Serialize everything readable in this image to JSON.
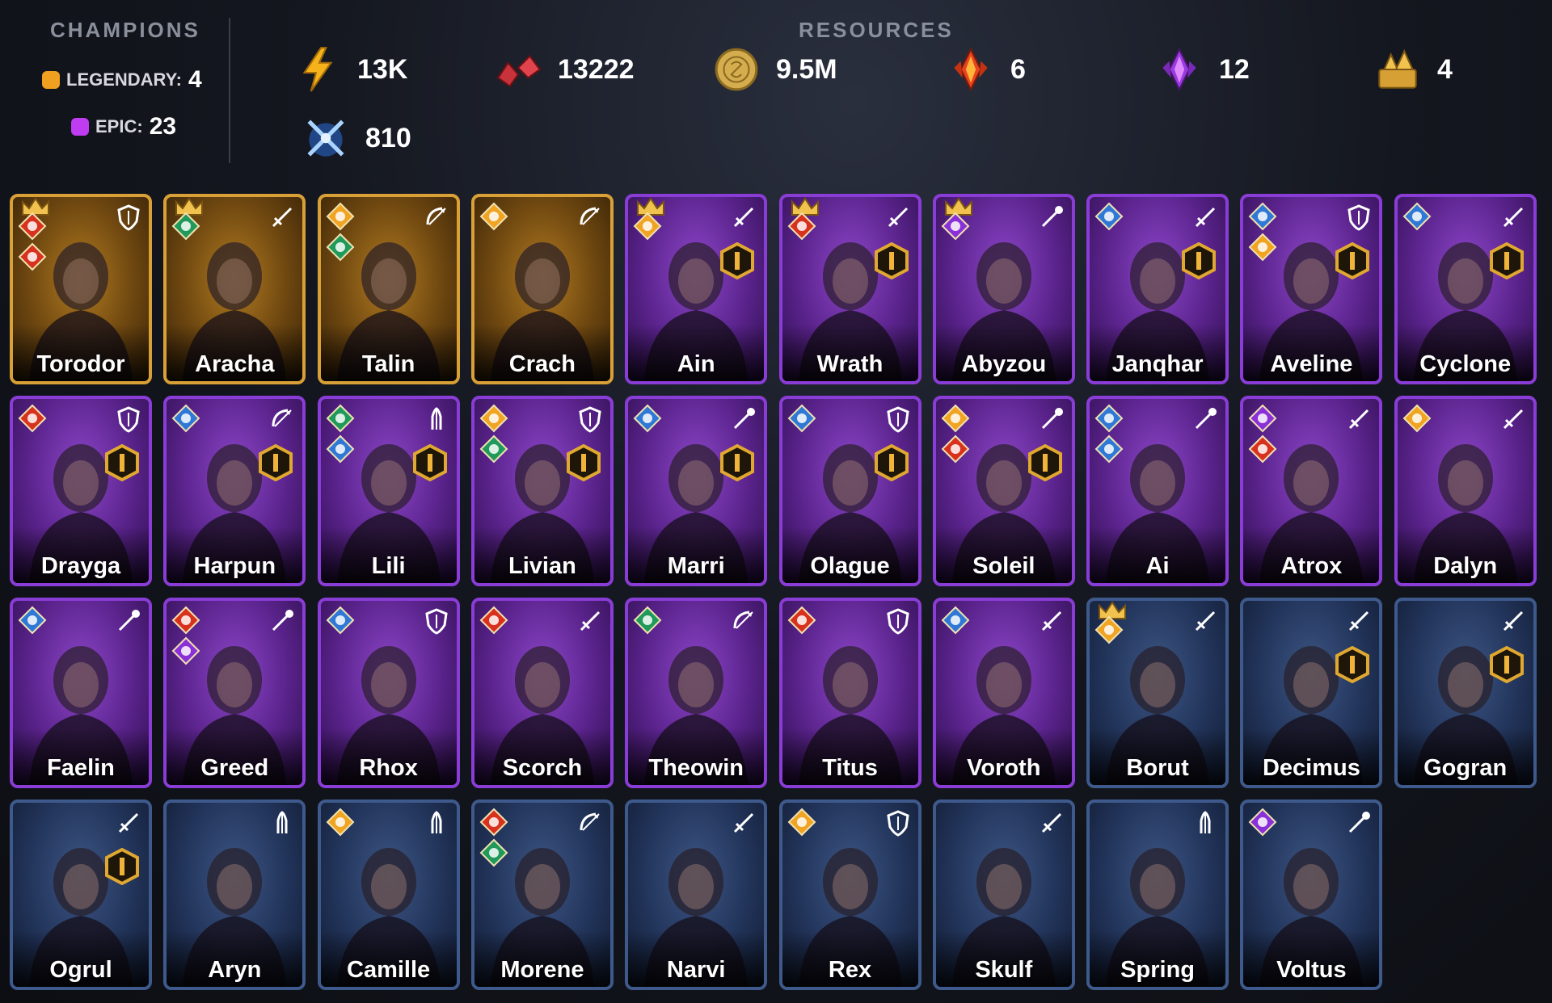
{
  "champions": {
    "title": "CHAMPIONS",
    "legendary_label": "LEGENDARY:",
    "legendary_count": "4",
    "epic_label": "EPIC:",
    "epic_count": "23"
  },
  "resources": {
    "title": "RESOURCES",
    "items": [
      {
        "icon": "energy-bolt-icon",
        "value": "13K"
      },
      {
        "icon": "gem-shards-icon",
        "value": "13222"
      },
      {
        "icon": "gold-coin-icon",
        "value": "9.5M"
      },
      {
        "icon": "fire-crystal-icon",
        "value": "6"
      },
      {
        "icon": "void-crystal-icon",
        "value": "12"
      },
      {
        "icon": "gold-pile-icon",
        "value": "4"
      },
      {
        "icon": "crossed-swords-icon",
        "value": "810"
      }
    ]
  },
  "colors": {
    "legendary": "#f0a020",
    "epic": "#c03cf0",
    "rare": "#3e5a8c"
  },
  "roster": [
    {
      "name": "Torodor",
      "rarity": "legendary",
      "crown": true,
      "affinities": [
        "fire",
        "fire"
      ],
      "role": "shield",
      "ascended": false
    },
    {
      "name": "Aracha",
      "rarity": "legendary",
      "crown": true,
      "affinities": [
        "nature"
      ],
      "role": "sword",
      "ascended": false
    },
    {
      "name": "Talin",
      "rarity": "legendary",
      "crown": false,
      "affinities": [
        "radiant",
        "nature"
      ],
      "role": "bow",
      "ascended": false
    },
    {
      "name": "Crach",
      "rarity": "legendary",
      "crown": false,
      "affinities": [
        "radiant"
      ],
      "role": "bow",
      "ascended": false
    },
    {
      "name": "Ain",
      "rarity": "epic",
      "crown": true,
      "affinities": [
        "radiant"
      ],
      "role": "sword",
      "ascended": true
    },
    {
      "name": "Wrath",
      "rarity": "epic",
      "crown": true,
      "affinities": [
        "fire"
      ],
      "role": "sword",
      "ascended": true
    },
    {
      "name": "Abyzou",
      "rarity": "epic",
      "crown": true,
      "affinities": [
        "void"
      ],
      "role": "staff",
      "ascended": false
    },
    {
      "name": "Janqhar",
      "rarity": "epic",
      "crown": false,
      "affinities": [
        "water"
      ],
      "role": "sword",
      "ascended": true
    },
    {
      "name": "Aveline",
      "rarity": "epic",
      "crown": false,
      "affinities": [
        "water",
        "radiant"
      ],
      "role": "shield",
      "ascended": true
    },
    {
      "name": "Cyclone",
      "rarity": "epic",
      "crown": false,
      "affinities": [
        "water"
      ],
      "role": "sword",
      "ascended": true
    },
    {
      "name": "Drayga",
      "rarity": "epic",
      "crown": false,
      "affinities": [
        "fire"
      ],
      "role": "shield",
      "ascended": true
    },
    {
      "name": "Harpun",
      "rarity": "epic",
      "crown": false,
      "affinities": [
        "water"
      ],
      "role": "bow",
      "ascended": true
    },
    {
      "name": "Lili",
      "rarity": "epic",
      "crown": false,
      "affinities": [
        "nature",
        "water"
      ],
      "role": "prayer",
      "ascended": true
    },
    {
      "name": "Livian",
      "rarity": "epic",
      "crown": false,
      "affinities": [
        "radiant",
        "nature"
      ],
      "role": "shield",
      "ascended": true
    },
    {
      "name": "Marri",
      "rarity": "epic",
      "crown": false,
      "affinities": [
        "water"
      ],
      "role": "staff",
      "ascended": true
    },
    {
      "name": "Olague",
      "rarity": "epic",
      "crown": false,
      "affinities": [
        "water"
      ],
      "role": "shield",
      "ascended": true
    },
    {
      "name": "Soleil",
      "rarity": "epic",
      "crown": false,
      "affinities": [
        "radiant",
        "fire"
      ],
      "role": "staff",
      "ascended": true
    },
    {
      "name": "Ai",
      "rarity": "epic",
      "crown": false,
      "affinities": [
        "water",
        "water"
      ],
      "role": "staff",
      "ascended": false
    },
    {
      "name": "Atrox",
      "rarity": "epic",
      "crown": false,
      "affinities": [
        "void",
        "fire"
      ],
      "role": "sword",
      "ascended": false
    },
    {
      "name": "Dalyn",
      "rarity": "epic",
      "crown": false,
      "affinities": [
        "radiant"
      ],
      "role": "sword",
      "ascended": false
    },
    {
      "name": "Faelin",
      "rarity": "epic",
      "crown": false,
      "affinities": [
        "water"
      ],
      "role": "staff",
      "ascended": false
    },
    {
      "name": "Greed",
      "rarity": "epic",
      "crown": false,
      "affinities": [
        "fire",
        "void"
      ],
      "role": "staff",
      "ascended": false
    },
    {
      "name": "Rhox",
      "rarity": "epic",
      "crown": false,
      "affinities": [
        "water"
      ],
      "role": "shield",
      "ascended": false
    },
    {
      "name": "Scorch",
      "rarity": "epic",
      "crown": false,
      "affinities": [
        "fire"
      ],
      "role": "sword",
      "ascended": false
    },
    {
      "name": "Theowin",
      "rarity": "epic",
      "crown": false,
      "affinities": [
        "nature"
      ],
      "role": "bow",
      "ascended": false
    },
    {
      "name": "Titus",
      "rarity": "epic",
      "crown": false,
      "affinities": [
        "fire"
      ],
      "role": "shield",
      "ascended": false
    },
    {
      "name": "Voroth",
      "rarity": "epic",
      "crown": false,
      "affinities": [
        "water"
      ],
      "role": "sword",
      "ascended": false
    },
    {
      "name": "Borut",
      "rarity": "rare",
      "crown": true,
      "affinities": [
        "radiant"
      ],
      "role": "sword",
      "ascended": false
    },
    {
      "name": "Decimus",
      "rarity": "rare",
      "crown": false,
      "affinities": [],
      "role": "sword",
      "ascended": true
    },
    {
      "name": "Gogran",
      "rarity": "rare",
      "crown": false,
      "affinities": [],
      "role": "sword",
      "ascended": true
    },
    {
      "name": "Ogrul",
      "rarity": "rare",
      "crown": false,
      "affinities": [],
      "role": "sword",
      "ascended": true
    },
    {
      "name": "Aryn",
      "rarity": "rare",
      "crown": false,
      "affinities": [],
      "role": "prayer",
      "ascended": false
    },
    {
      "name": "Camille",
      "rarity": "rare",
      "crown": false,
      "affinities": [
        "radiant"
      ],
      "role": "prayer",
      "ascended": false
    },
    {
      "name": "Morene",
      "rarity": "rare",
      "crown": false,
      "affinities": [
        "fire",
        "nature"
      ],
      "role": "bow",
      "ascended": false
    },
    {
      "name": "Narvi",
      "rarity": "rare",
      "crown": false,
      "affinities": [],
      "role": "sword",
      "ascended": false
    },
    {
      "name": "Rex",
      "rarity": "rare",
      "crown": false,
      "affinities": [
        "radiant"
      ],
      "role": "shield",
      "ascended": false
    },
    {
      "name": "Skulf",
      "rarity": "rare",
      "crown": false,
      "affinities": [],
      "role": "sword",
      "ascended": false
    },
    {
      "name": "Spring",
      "rarity": "rare",
      "crown": false,
      "affinities": [],
      "role": "prayer",
      "ascended": false
    },
    {
      "name": "Voltus",
      "rarity": "rare",
      "crown": false,
      "affinities": [
        "void"
      ],
      "role": "staff",
      "ascended": false
    }
  ]
}
